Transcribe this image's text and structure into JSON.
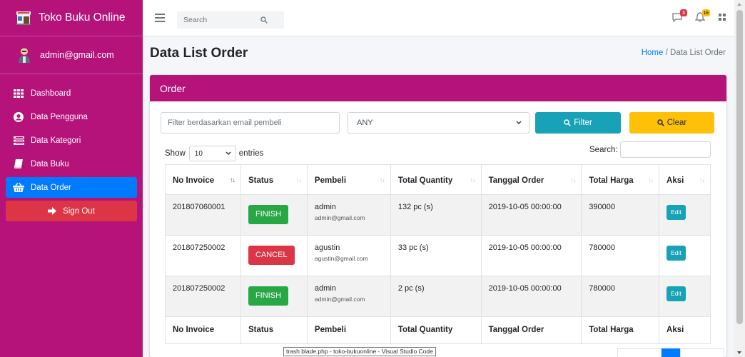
{
  "app": {
    "title": "Toko Buku Online"
  },
  "user": {
    "email": "admin@gmail.com"
  },
  "sidebar": {
    "items": [
      {
        "label": "Dashboard",
        "icon": "th-icon"
      },
      {
        "label": "Data Pengguna",
        "icon": "user-circle-icon"
      },
      {
        "label": "Data Kategori",
        "icon": "list-icon"
      },
      {
        "label": "Data Buku",
        "icon": "book-icon"
      },
      {
        "label": "Data Order",
        "icon": "shopping-basket-icon",
        "active": true
      }
    ],
    "signout": "Sign Out"
  },
  "navbar": {
    "search_placeholder": "Search",
    "messages_badge": "3",
    "notifications_badge": "15"
  },
  "page": {
    "title": "Data List Order",
    "breadcrumb": {
      "home": "Home",
      "separator": "/",
      "current": "Data List Order"
    }
  },
  "card": {
    "title": "Order",
    "filter_placeholder": "Filter berdasarkan email pembeli",
    "select_value": "ANY",
    "filter_label": "Filter",
    "clear_label": "Clear",
    "show_label": "Show",
    "entries_value": "10",
    "entries_label": "entries",
    "search_label": "Search:"
  },
  "table": {
    "headers": [
      "No Invoice",
      "Status",
      "Pembeli",
      "Total Quantity",
      "Tanggal Order",
      "Total Harga",
      "Aksi"
    ],
    "rows": [
      {
        "invoice": "201807060001",
        "status": "FINISH",
        "buyer": "admin",
        "email": "admin@gmail.com",
        "qty": "132 pc (s)",
        "date": "2019-10-05 00:00:00",
        "total": "390000",
        "action": "Edit"
      },
      {
        "invoice": "201807250002",
        "status": "CANCEL",
        "buyer": "agustin",
        "email": "agustin@gmail.com",
        "qty": "33 pc (s)",
        "date": "2019-10-05 00:00:00",
        "total": "780000",
        "action": "Edit"
      },
      {
        "invoice": "201807250002",
        "status": "FINISH",
        "buyer": "admin",
        "email": "admin@gmail.com",
        "qty": "2 pc (s)",
        "date": "2019-10-05 00:00:00",
        "total": "780000",
        "action": "Edit"
      }
    ]
  },
  "tooltip": "trash.blade.php - toko-bukuonline - Visual Studio Code",
  "colors": {
    "sidebar": "#b5127a",
    "active": "#007bff",
    "danger": "#dc3545",
    "success": "#28a745",
    "info": "#17a2b8",
    "warning": "#ffc107"
  }
}
